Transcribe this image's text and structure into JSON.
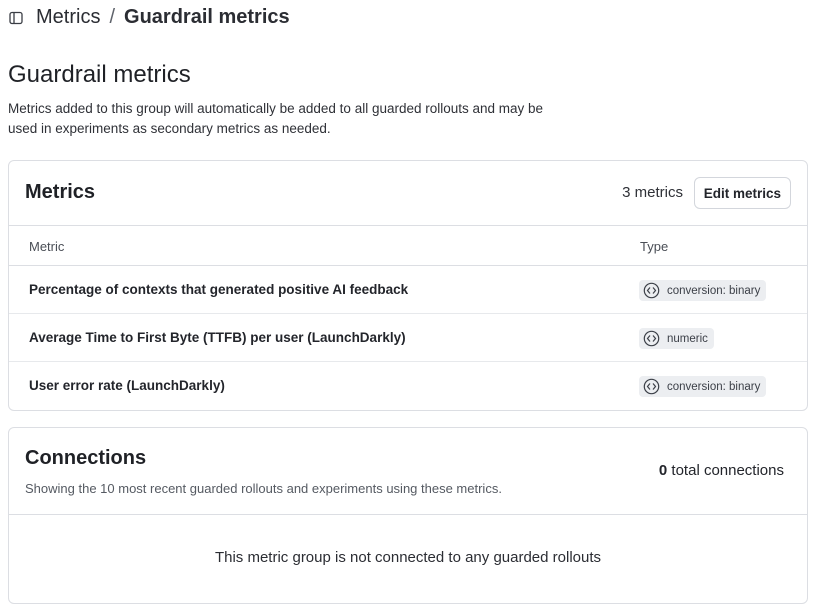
{
  "breadcrumb": {
    "parent": "Metrics",
    "separator": "/",
    "current": "Guardrail metrics"
  },
  "page": {
    "title": "Guardrail metrics",
    "description": "Metrics added to this group will automatically be added to all guarded rollouts and may be used in experiments as secondary metrics as needed."
  },
  "metrics_card": {
    "title": "Metrics",
    "count_label": "3 metrics",
    "edit_button": "Edit metrics",
    "columns": [
      "Metric",
      "Type"
    ],
    "rows": [
      {
        "name": "Percentage of contexts that generated positive AI feedback",
        "type": "conversion: binary"
      },
      {
        "name": "Average Time to First Byte (TTFB) per user (LaunchDarkly)",
        "type": "numeric"
      },
      {
        "name": "User error rate (LaunchDarkly)",
        "type": "conversion: binary"
      }
    ]
  },
  "connections_card": {
    "title": "Connections",
    "subtitle": "Showing the 10 most recent guarded rollouts and experiments using these metrics.",
    "total_number": "0",
    "total_label": "total connections",
    "empty_message": "This metric group is not connected to any guarded rollouts"
  },
  "icons": {
    "sidebar_toggle": "sidebar-icon",
    "metric_type": "code-circle-icon"
  },
  "colors": {
    "border": "#dcdee3",
    "badge_bg": "#eceef1",
    "text": "#23252b"
  }
}
